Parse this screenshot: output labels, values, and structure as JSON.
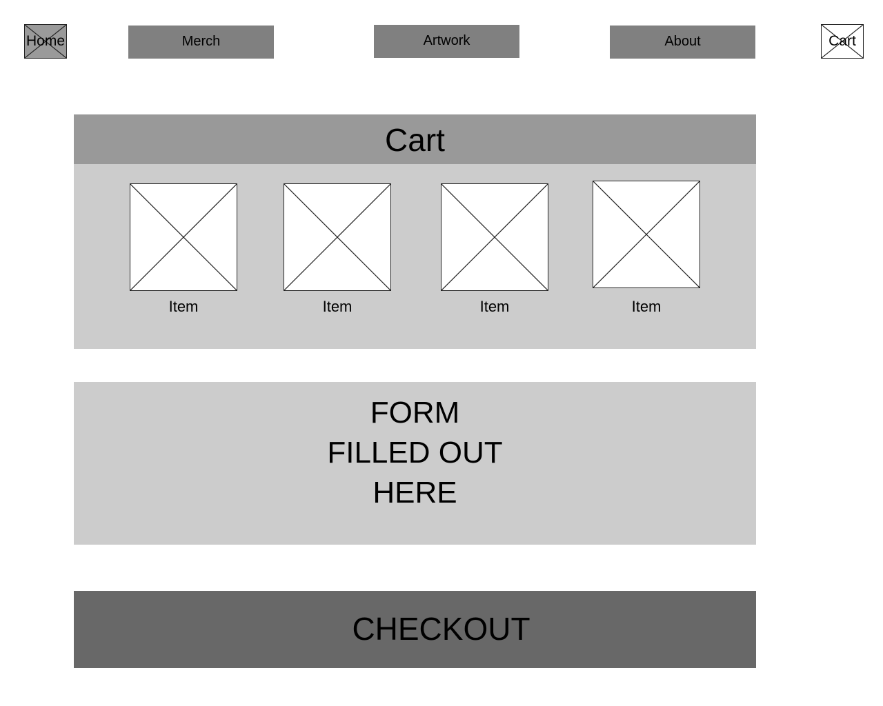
{
  "nav": {
    "home_label": "Home",
    "merch_label": "Merch",
    "artwork_label": "Artwork",
    "about_label": "About",
    "cart_label": "Cart"
  },
  "cart": {
    "title": "Cart",
    "items": [
      {
        "label": "Item"
      },
      {
        "label": "Item"
      },
      {
        "label": "Item"
      },
      {
        "label": "Item"
      }
    ]
  },
  "form": {
    "lines": [
      "FORM",
      "FILLED OUT",
      "HERE"
    ]
  },
  "checkout": {
    "label": "CHECKOUT"
  },
  "colors": {
    "nav_button": "#808080",
    "header": "#999999",
    "panel": "#cccccc",
    "checkout": "#686868"
  }
}
